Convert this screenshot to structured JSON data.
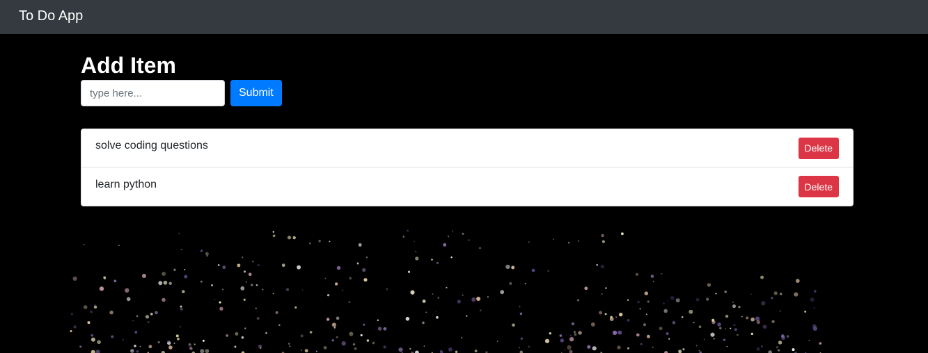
{
  "navbar": {
    "brand": "To Do App"
  },
  "form": {
    "title": "Add Item",
    "input_value": "",
    "input_placeholder": "type here...",
    "submit_label": "Submit"
  },
  "todos": {
    "items": [
      {
        "text": "solve coding questions",
        "delete_label": "Delete"
      },
      {
        "text": "learn python",
        "delete_label": "Delete"
      }
    ]
  },
  "colors": {
    "navbar_bg": "#343a40",
    "page_bg": "#000000",
    "primary": "#007bff",
    "danger": "#dc3545"
  }
}
